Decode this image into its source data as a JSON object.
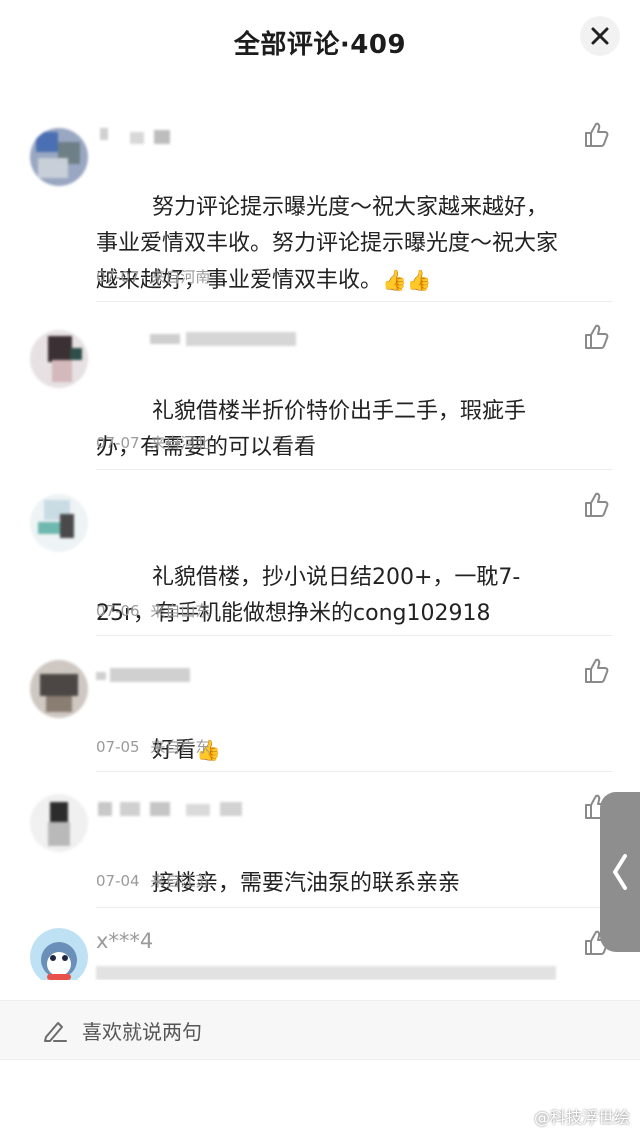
{
  "header": {
    "title": "全部评论·409"
  },
  "close_label": "✕",
  "comments": [
    {
      "username": "",
      "text": "努力评论提示曝光度～祝大家越来越好，事业爱情双丰收。努力评论提示曝光度～祝大家越来越好，事业爱情双丰收。",
      "emoji": "👍👍",
      "date": "07-07",
      "location": "来自河南"
    },
    {
      "username": "",
      "text": "礼貌借楼半折价特价出手二手，瑕疵手办，有需要的可以看看",
      "emoji": "",
      "date": "07-07",
      "location": "来自河北"
    },
    {
      "username": "",
      "text": "礼貌借楼，抄小说日结200+，一耽7-25r，有手机能做想挣米的cong102918",
      "emoji": "",
      "date": "07-06",
      "location": "来自山东"
    },
    {
      "username": "",
      "text": "好看",
      "emoji": "👍",
      "date": "07-05",
      "location": "来自广东"
    },
    {
      "username": "",
      "text": "接楼亲，需要汽油泵的联系亲亲",
      "emoji": "",
      "date": "07-04",
      "location": "来自江苏"
    },
    {
      "username": "x***4",
      "text": "",
      "emoji": "",
      "date": "",
      "location": ""
    }
  ],
  "input": {
    "placeholder": "喜欢就说两句"
  },
  "watermark": "@科技浮世绘",
  "colors": {
    "text": "#222222",
    "meta": "#9a9a9a",
    "divider": "#ececec",
    "accent": "#f0b23a"
  }
}
